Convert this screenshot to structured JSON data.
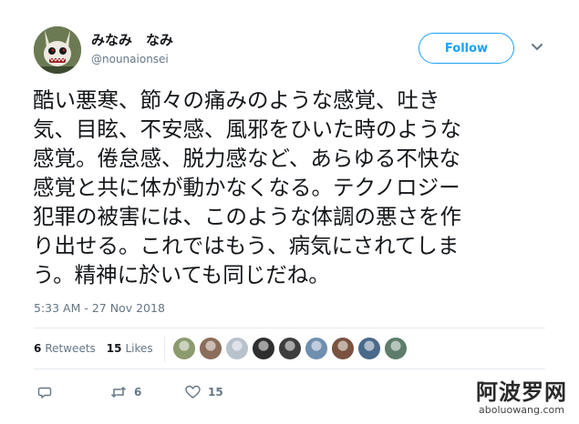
{
  "tweet": {
    "author": {
      "display_name": "みなみ　なみ",
      "handle": "@nounaionsei",
      "avatar_icon": "avatar-rabbit-creature-icon"
    },
    "follow_label": "Follow",
    "menu_icon": "chevron-down-icon",
    "text_lines": [
      "酷い悪寒、節々の痛みのような感覚、吐き",
      "気、目眩、不安感、風邪をひいた時のような",
      "感覚。倦怠感、脱力感など、あらゆる不快な",
      "感覚と共に体が動かなくなる。テクノロジー",
      "犯罪の被害には、このような体調の悪さを作",
      "り出せる。これではもう、病気にされてしま",
      "う。精神に於いても同じだね。"
    ],
    "timestamp": "5:33 AM - 27 Nov 2018",
    "stats": {
      "retweets_count": "6",
      "retweets_label": "Retweets",
      "likes_count": "15",
      "likes_label": "Likes"
    },
    "likers": [
      {
        "icon": "liker-avatar-1",
        "color": "#8c9a6e"
      },
      {
        "icon": "liker-avatar-2",
        "color": "#8a6d5a"
      },
      {
        "icon": "liker-avatar-3",
        "color": "#b8c2cc"
      },
      {
        "icon": "liker-avatar-4",
        "color": "#2f2f2f"
      },
      {
        "icon": "liker-avatar-5",
        "color": "#3d3d3d"
      },
      {
        "icon": "liker-avatar-6",
        "color": "#6f8fb0"
      },
      {
        "icon": "liker-avatar-7",
        "color": "#7a5240"
      },
      {
        "icon": "liker-avatar-8",
        "color": "#4a6a8a"
      },
      {
        "icon": "liker-avatar-9",
        "color": "#5d7d6a"
      }
    ],
    "actions": {
      "reply_icon": "reply-icon",
      "retweet_icon": "retweet-icon",
      "retweet_count": "6",
      "like_icon": "heart-icon",
      "like_count": "15"
    },
    "colors": {
      "accent": "#1da1f2",
      "text": "#14171a",
      "muted": "#657786",
      "divider": "#e6ecf0"
    }
  },
  "watermark": {
    "chinese": "阿波罗网",
    "url": "aboluowang.com"
  }
}
